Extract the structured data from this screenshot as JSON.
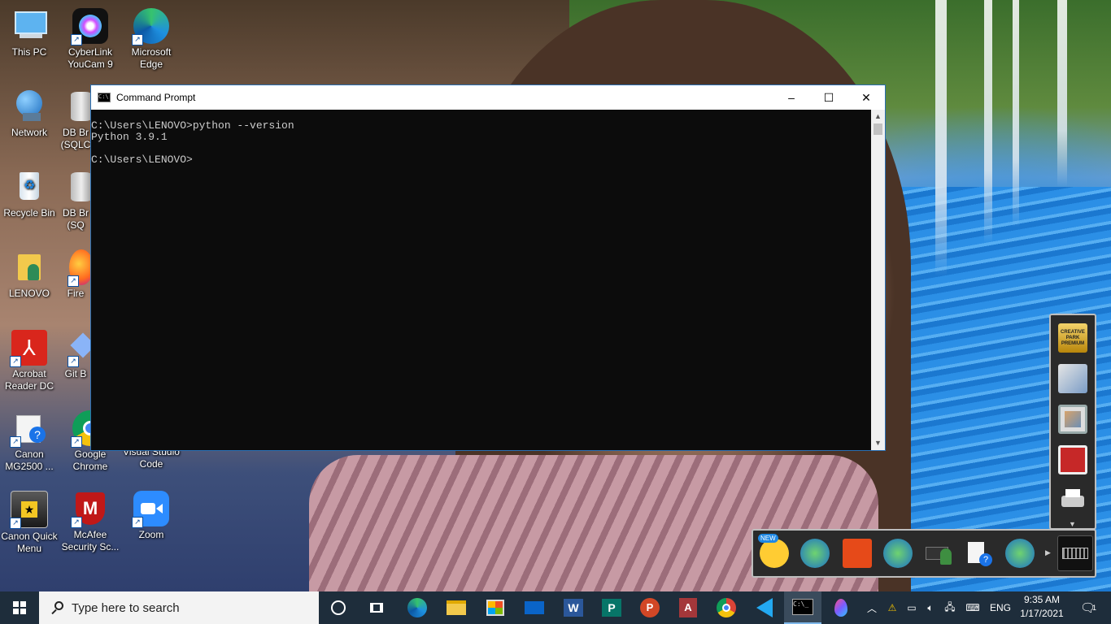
{
  "desktop": {
    "icons": [
      {
        "label": "This PC",
        "icon": "computer-icon"
      },
      {
        "label": "CyberLink YouCam 9",
        "icon": "youcam-icon"
      },
      {
        "label": "Microsoft Edge",
        "icon": "edge-icon"
      },
      {
        "label": "Network",
        "icon": "network-icon"
      },
      {
        "label": "DB Br (SQLC",
        "icon": "database-icon"
      },
      {
        "label": "Recycle Bin",
        "icon": "recycle-bin-icon"
      },
      {
        "label": "DB Br (SQ",
        "icon": "database-icon"
      },
      {
        "label": "LENOVO",
        "icon": "user-folder-icon"
      },
      {
        "label": "Fire",
        "icon": "firefox-icon"
      },
      {
        "label": "Acrobat Reader DC",
        "icon": "acrobat-icon"
      },
      {
        "label": "Git B",
        "icon": "git-icon"
      },
      {
        "label": "Canon MG2500 ...",
        "icon": "printer-help-icon"
      },
      {
        "label": "Google Chrome",
        "icon": "chrome-icon"
      },
      {
        "label": "Visual Studio Code",
        "icon": "vscode-icon"
      },
      {
        "label": "Canon Quick Menu",
        "icon": "canon-quick-menu-icon"
      },
      {
        "label": "McAfee Security Sc...",
        "icon": "mcafee-icon"
      },
      {
        "label": "Zoom",
        "icon": "zoom-icon"
      }
    ]
  },
  "cmd_window": {
    "title": "Command Prompt",
    "lines": [
      "C:\\Users\\LENOVO>python --version",
      "Python 3.9.1",
      "",
      "C:\\Users\\LENOVO>"
    ],
    "minimize_symbol": "–",
    "maximize_symbol": "☐",
    "close_symbol": "✕"
  },
  "quick_menu": {
    "vertical_items": [
      {
        "label": "CREATIVE PARK PREMIUM",
        "icon": "creative-park-icon"
      },
      {
        "icon": "photo-gallery-icon"
      },
      {
        "icon": "photo-print-icon"
      },
      {
        "icon": "film-print-icon"
      },
      {
        "icon": "printer-icon"
      }
    ],
    "horizontal_items": [
      {
        "badge": "NEW",
        "icon": "new-notice-icon"
      },
      {
        "icon": "photo-info-icon"
      },
      {
        "icon": "photo-album-icon"
      },
      {
        "icon": "shopping-cart-icon"
      },
      {
        "icon": "printer-person-icon"
      },
      {
        "icon": "manual-help-icon"
      },
      {
        "icon": "web-help-icon"
      },
      {
        "icon": "keyboard-icon"
      }
    ]
  },
  "taskbar": {
    "search_placeholder": "Type here to search",
    "apps": [
      "cortana-icon",
      "task-view-icon",
      "edge-icon",
      "file-explorer-icon",
      "store-icon",
      "mail-icon",
      "word-icon",
      "publisher-icon",
      "powerpoint-icon",
      "access-icon",
      "chrome-icon",
      "vscode-icon",
      "cmd-icon",
      "paint-icon"
    ],
    "language": "ENG",
    "time": "9:35 AM",
    "date": "1/17/2021",
    "notification_count": "1"
  }
}
